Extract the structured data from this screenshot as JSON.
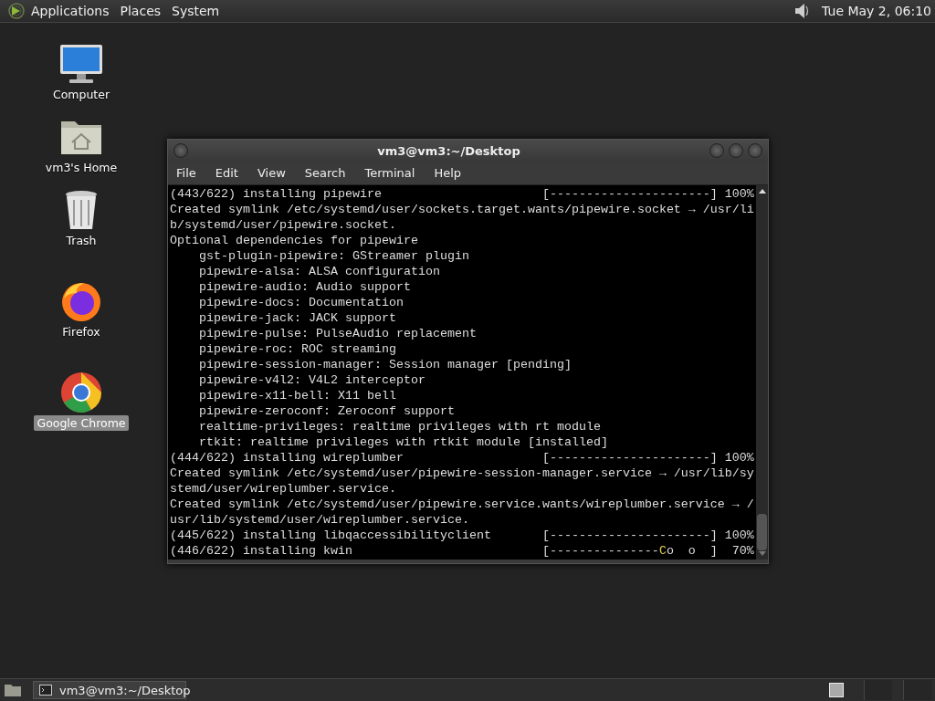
{
  "top_panel": {
    "menus": [
      "Applications",
      "Places",
      "System"
    ],
    "clock": "Tue May  2, 06:10"
  },
  "desktop_icons": [
    {
      "kind": "computer",
      "label": "Computer",
      "selected": false
    },
    {
      "kind": "home",
      "label": "vm3's Home",
      "selected": false
    },
    {
      "kind": "trash",
      "label": "Trash",
      "selected": false
    },
    {
      "kind": "firefox",
      "label": "Firefox",
      "selected": false
    },
    {
      "kind": "chrome",
      "label": "Google Chrome",
      "selected": true
    }
  ],
  "window": {
    "title": "vm3@vm3:~/Desktop",
    "menu": [
      "File",
      "Edit",
      "View",
      "Search",
      "Terminal",
      "Help"
    ],
    "lines": [
      {
        "kind": "progress",
        "label": "(443/622) installing pipewire",
        "bar": "[----------------------]",
        "percent": "100%"
      },
      {
        "kind": "text",
        "text": "Created symlink /etc/systemd/user/sockets.target.wants/pipewire.socket → /usr/li"
      },
      {
        "kind": "text",
        "text": "b/systemd/user/pipewire.socket."
      },
      {
        "kind": "text",
        "text": "Optional dependencies for pipewire"
      },
      {
        "kind": "text",
        "text": "    gst-plugin-pipewire: GStreamer plugin"
      },
      {
        "kind": "text",
        "text": "    pipewire-alsa: ALSA configuration"
      },
      {
        "kind": "text",
        "text": "    pipewire-audio: Audio support"
      },
      {
        "kind": "text",
        "text": "    pipewire-docs: Documentation"
      },
      {
        "kind": "text",
        "text": "    pipewire-jack: JACK support"
      },
      {
        "kind": "text",
        "text": "    pipewire-pulse: PulseAudio replacement"
      },
      {
        "kind": "text",
        "text": "    pipewire-roc: ROC streaming"
      },
      {
        "kind": "text",
        "text": "    pipewire-session-manager: Session manager [pending]"
      },
      {
        "kind": "text",
        "text": "    pipewire-v4l2: V4L2 interceptor"
      },
      {
        "kind": "text",
        "text": "    pipewire-x11-bell: X11 bell"
      },
      {
        "kind": "text",
        "text": "    pipewire-zeroconf: Zeroconf support"
      },
      {
        "kind": "text",
        "text": "    realtime-privileges: realtime privileges with rt module"
      },
      {
        "kind": "text",
        "text": "    rtkit: realtime privileges with rtkit module [installed]"
      },
      {
        "kind": "progress",
        "label": "(444/622) installing wireplumber",
        "bar": "[----------------------]",
        "percent": "100%"
      },
      {
        "kind": "text",
        "text": "Created symlink /etc/systemd/user/pipewire-session-manager.service → /usr/lib/sy"
      },
      {
        "kind": "text",
        "text": "stemd/user/wireplumber.service."
      },
      {
        "kind": "text",
        "text": "Created symlink /etc/systemd/user/pipewire.service.wants/wireplumber.service → /"
      },
      {
        "kind": "text",
        "text": "usr/lib/systemd/user/wireplumber.service."
      },
      {
        "kind": "progress",
        "label": "(445/622) installing libqaccessibilityclient",
        "bar": "[----------------------]",
        "percent": "100%"
      },
      {
        "kind": "progress",
        "label": "(446/622) installing kwin",
        "bar": "[---------------",
        "pacman": "C",
        "bar_rest": "o  o  ]",
        "percent": "70%"
      }
    ]
  },
  "taskbar": {
    "tasks": [
      {
        "label": "vm3@vm3:~/Desktop",
        "selected": false
      }
    ]
  }
}
